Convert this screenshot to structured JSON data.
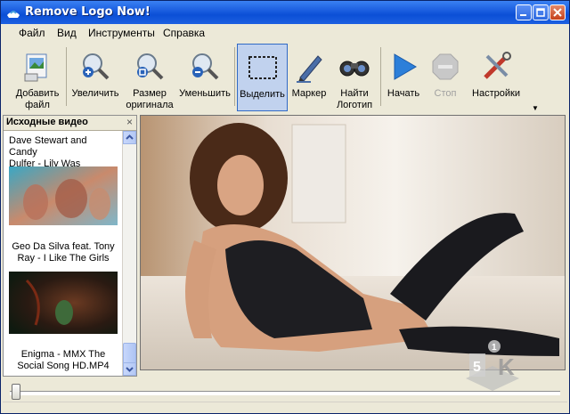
{
  "window": {
    "title": "Remove Logo Now!"
  },
  "menu": {
    "items": [
      "Файл",
      "Вид",
      "Инструменты",
      "Справка"
    ]
  },
  "toolbar": {
    "add_file_line1": "Добавить",
    "add_file_line2": "файл",
    "zoom_in": "Увеличить",
    "original_line1": "Размер",
    "original_line2": "оригинала",
    "zoom_out": "Уменьшить",
    "select": "Выделить",
    "marker": "Маркер",
    "find_logo_line1": "Найти",
    "find_logo_line2": "Логотип",
    "start": "Начать",
    "stop": "Стоп",
    "settings": "Настройки"
  },
  "panel": {
    "title": "Исходные видео",
    "videos": [
      {
        "line1": "Dave Stewart and Candy",
        "line2": "Dulfer - Lily Was Here.avi"
      },
      {
        "line1": "Geo Da Silva feat. Tony",
        "line2": "Ray - I Like The Girls"
      },
      {
        "line1": "Enigma - MMX The",
        "line2": "Social Song HD.MP4"
      }
    ]
  },
  "colors": {
    "titlebar": "#0b4fd6",
    "selected": "#c1d2ee",
    "accent": "#316ac5"
  },
  "watermark": {
    "top": "1",
    "left": "5",
    "right": "K"
  }
}
